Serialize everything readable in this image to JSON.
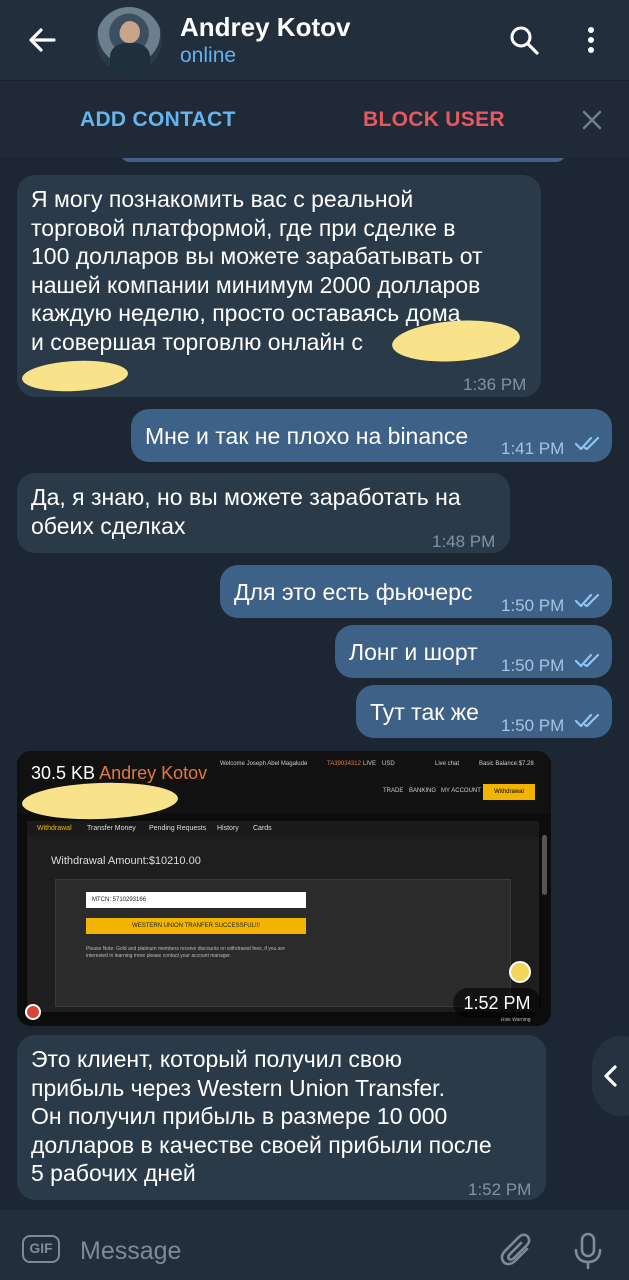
{
  "header": {
    "name": "Andrey Kotov",
    "status": "online"
  },
  "actions": {
    "add_contact": "ADD CONTACT",
    "block_user": "BLOCK USER"
  },
  "messages": [
    {
      "dir": "in",
      "text_lines": [
        "Я могу познакомить вас с реальной",
        "торговой платформой, где при сделке в",
        "100 долларов вы можете зарабатывать от",
        "нашей компании минимум 2000 долларов",
        "каждую неделю, просто оставаясь дома",
        "и совершая торговлю онлайн с"
      ],
      "time": "1:36 PM"
    },
    {
      "dir": "out",
      "text": "Мне и так не плохо на binance",
      "time": "1:41 PM"
    },
    {
      "dir": "in",
      "text_lines": [
        "Да, я знаю, но вы можете заработать на",
        "обеих сделках"
      ],
      "time": "1:48 PM"
    },
    {
      "dir": "out",
      "text": "Для это есть фьючерс",
      "time": "1:50 PM"
    },
    {
      "dir": "out",
      "text": "Лонг и шорт",
      "time": "1:50 PM"
    },
    {
      "dir": "out",
      "text": "Тут так же",
      "time": "1:50 PM"
    },
    {
      "dir": "in",
      "text_lines": [
        "Это клиент, который получил свою",
        "прибыль через Western Union Transfer.",
        "Он получил прибыль в размере 10 000",
        "долларов в качестве своей прибыли после",
        "5 рабочих дней"
      ],
      "time": "1:52 PM"
    }
  ],
  "image_message": {
    "size": "30.5 KB",
    "sender": "Andrey Kotov",
    "time": "1:52 PM",
    "screenshot": {
      "welcome": "Welcome Joseph Abel Magalude",
      "account": "TA39034312",
      "live": "LIVE",
      "currency": "USD",
      "live_chat": "Live chat",
      "balance": "Basic Balance:$7.28",
      "nav_trade": "TRADE",
      "nav_banking": "BANKING",
      "nav_account": "MY ACCOUNT",
      "withdrawal_btn": "Withdrawal",
      "tab_withdrawal": "Withdrawal",
      "tab_transfer": "Transfer Money",
      "tab_pending": "Pending Requests",
      "tab_history": "History",
      "tab_cards": "Cards",
      "amount": "Withdrawal Amount:$10210.00",
      "mtcn": "MTCN: 5710293166",
      "wu_status": "WESTERN UNION TRANFER SUCCESSFUL!!!",
      "note": "Please Note: Gold and platinum members receive discounts on withdrawal fees, if you are interested in learning more please contact your account manager.",
      "risk": "Risk Warning"
    }
  },
  "input": {
    "placeholder": "Message",
    "gif_label": "GIF"
  },
  "colors": {
    "background": "#1c2733",
    "header": "#222e3b",
    "incoming": "#2b3a49",
    "outgoing": "#3e6188",
    "accent": "#5fb2f0",
    "danger": "#e8585e"
  }
}
